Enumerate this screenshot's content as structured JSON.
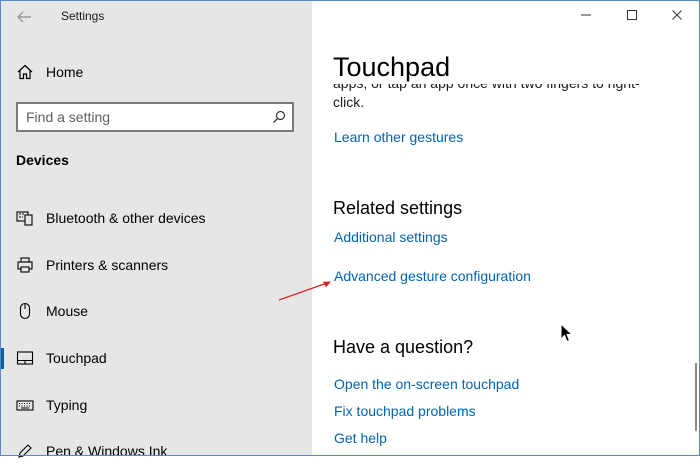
{
  "window": {
    "title": "Settings"
  },
  "sidebar": {
    "home_label": "Home",
    "search_placeholder": "Find a setting",
    "section_title": "Devices",
    "items": [
      {
        "label": "Bluetooth & other devices",
        "icon": "bluetooth-devices-icon"
      },
      {
        "label": "Printers & scanners",
        "icon": "printer-icon"
      },
      {
        "label": "Mouse",
        "icon": "mouse-icon"
      },
      {
        "label": "Touchpad",
        "icon": "touchpad-icon",
        "selected": true
      },
      {
        "label": "Typing",
        "icon": "keyboard-icon"
      },
      {
        "label": "Pen & Windows Ink",
        "icon": "pen-icon"
      }
    ]
  },
  "main": {
    "title": "Touchpad",
    "partial_text_line1": "apps, or tap an app once with two fingers to right-",
    "partial_text_line2": "click.",
    "learn_gestures_link": "Learn other gestures",
    "related_heading": "Related settings",
    "related_links": [
      "Additional settings",
      "Advanced gesture configuration"
    ],
    "question_heading": "Have a question?",
    "question_links": [
      "Open the on-screen touchpad",
      "Fix touchpad problems",
      "Get help"
    ]
  },
  "colors": {
    "accent": "#0063b1",
    "sidebar_bg": "#e6e6e6",
    "annotation_arrow": "#e02020"
  }
}
